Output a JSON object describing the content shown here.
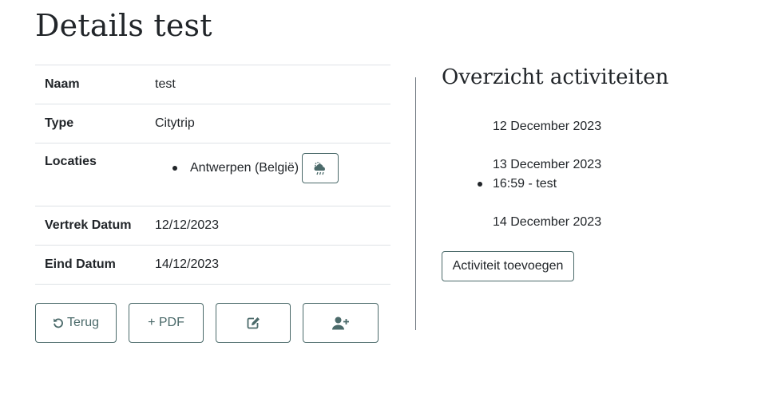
{
  "page": {
    "title": "Details test"
  },
  "details": {
    "naam": {
      "label": "Naam",
      "value": "test"
    },
    "type": {
      "label": "Type",
      "value": "Citytrip"
    },
    "locaties": {
      "label": "Locaties",
      "items": [
        "Antwerpen (België)"
      ]
    },
    "vertrek": {
      "label": "Vertrek Datum",
      "value": "12/12/2023"
    },
    "eind": {
      "label": "Eind Datum",
      "value": "14/12/2023"
    }
  },
  "actions": {
    "back_label": "Terug",
    "pdf_label": "+ PDF",
    "edit_icon": "edit-icon",
    "add_user_icon": "user-plus-icon"
  },
  "overview": {
    "title": "Overzicht activiteiten",
    "days": [
      {
        "date": "12 December 2023",
        "activities": []
      },
      {
        "date": "13 December 2023",
        "activities": [
          "16:59 - test"
        ]
      },
      {
        "date": "14 December 2023",
        "activities": []
      }
    ],
    "add_label": "Activiteit toevoegen"
  },
  "colors": {
    "accent": "#4b6a6a",
    "border": "#dee2e6",
    "text": "#212529"
  }
}
